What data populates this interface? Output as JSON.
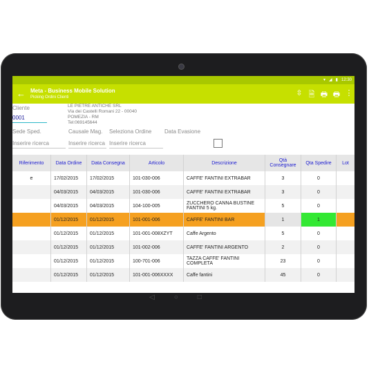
{
  "status": {
    "time": "12:30",
    "icons": [
      "wifi-icon",
      "signal-icon",
      "battery-icon"
    ]
  },
  "header": {
    "title": "Meta - Business Mobile Solution",
    "subtitle": "Picking Ordini Clienti"
  },
  "actions": [
    {
      "name": "collapse-icon",
      "glyph": "⇳"
    },
    {
      "name": "document-icon",
      "glyph": "🗎"
    },
    {
      "name": "printer-icon",
      "glyph": "🖶"
    },
    {
      "name": "printer-2-icon",
      "glyph": "🖶"
    },
    {
      "name": "more-icon",
      "glyph": "⋮"
    }
  ],
  "form": {
    "cliente_label": "Cliente",
    "cliente_value": "0001",
    "customer": {
      "name": "LE PIETRE ANTICHE  SRL",
      "address": "Via dei Castelli Romani 22 - 00040",
      "city": "POMEZIA - RM",
      "tel": "Tel:069145644"
    },
    "sede_label": "Sede Sped.",
    "causale_label": "Causale Mag.",
    "ordine_label": "Seleziona Ordine",
    "data_evasione_label": "Data Evasione",
    "search_placeholder": "Inserire ricerca"
  },
  "table": {
    "columns": [
      "Riferimento",
      "Data Ordine",
      "Data Consegna",
      "Articolo",
      "Descrizione",
      "Qtà Consegnare",
      "Qta Spedire",
      "Lot"
    ],
    "rows": [
      {
        "rif": "e",
        "data_ordine": "17/02/2015",
        "data_consegna": "17/02/2015",
        "articolo": "101-030-006",
        "descrizione": "CAFFE' FANTINI EXTRABAR",
        "qta_consegnare": "3",
        "qta_spedire": "0"
      },
      {
        "rif": "",
        "data_ordine": "04/03/2015",
        "data_consegna": "04/03/2015",
        "articolo": "101-030-006",
        "descrizione": "CAFFE' FANTINI EXTRABAR",
        "qta_consegnare": "3",
        "qta_spedire": "0"
      },
      {
        "rif": "",
        "data_ordine": "04/03/2015",
        "data_consegna": "04/03/2015",
        "articolo": "104-100-005",
        "descrizione": "ZUCCHERO CANNA BUSTINE FANTINI 5 kg.",
        "qta_consegnare": "5",
        "qta_spedire": "0"
      },
      {
        "rif": "",
        "data_ordine": "01/12/2015",
        "data_consegna": "01/12/2015",
        "articolo": "101-001-006",
        "descrizione": "CAFFE' FANTINI BAR",
        "qta_consegnare": "1",
        "qta_spedire": "1"
      },
      {
        "rif": "",
        "data_ordine": "01/12/2015",
        "data_consegna": "01/12/2015",
        "articolo": "101-001-008XZYT",
        "descrizione": "Caffe Argento",
        "qta_consegnare": "5",
        "qta_spedire": "0"
      },
      {
        "rif": "",
        "data_ordine": "01/12/2015",
        "data_consegna": "01/12/2015",
        "articolo": "101-002-006",
        "descrizione": "CAFFE' FANTINI ARGENTO",
        "qta_consegnare": "2",
        "qta_spedire": "0"
      },
      {
        "rif": "",
        "data_ordine": "01/12/2015",
        "data_consegna": "01/12/2015",
        "articolo": "100-701-006",
        "descrizione": "TAZZA CAFFE' FANTINI COMPLETA",
        "qta_consegnare": "23",
        "qta_spedire": "0"
      },
      {
        "rif": "",
        "data_ordine": "01/12/2015",
        "data_consegna": "01/12/2015",
        "articolo": "101-001-006XXXX",
        "descrizione": "Caffe fantini",
        "qta_consegnare": "45",
        "qta_spedire": "0"
      }
    ],
    "selected_row": 3
  },
  "colors": {
    "accent": "#c6e000",
    "selected_row": "#f5a020",
    "qty_highlight": "#33e833"
  }
}
